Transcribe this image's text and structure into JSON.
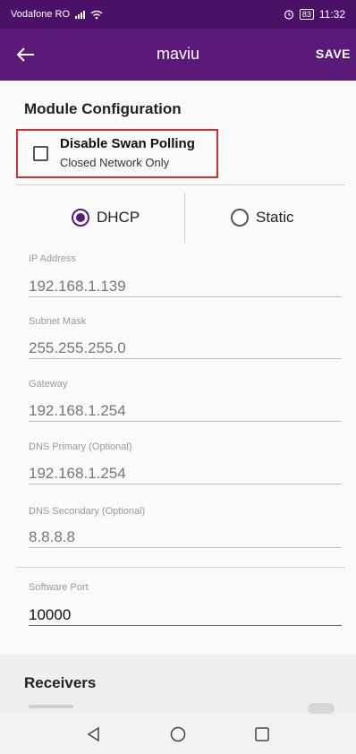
{
  "status_bar": {
    "carrier": "Vodafone RO",
    "battery": "83",
    "time": "11:32"
  },
  "toolbar": {
    "title": "maviu",
    "save_label": "SAVE"
  },
  "module": {
    "title": "Module Configuration",
    "disable_polling": {
      "label": "Disable Swan Polling",
      "sublabel": "Closed Network Only",
      "checked": false
    },
    "network_mode": {
      "options": [
        "DHCP",
        "Static"
      ],
      "selected": "DHCP"
    }
  },
  "fields": {
    "ip_address": {
      "label": "IP Address",
      "value": "192.168.1.139"
    },
    "subnet_mask": {
      "label": "Subnet Mask",
      "value": "255.255.255.0"
    },
    "gateway": {
      "label": "Gateway",
      "value": "192.168.1.254"
    },
    "dns_primary": {
      "label": "DNS Primary (Optional)",
      "value": "192.168.1.254"
    },
    "dns_secondary": {
      "label": "DNS Secondary (Optional)",
      "value": "8.8.8.8"
    },
    "software_port": {
      "label": "Software Port",
      "value": "10000"
    }
  },
  "receivers": {
    "title": "Receivers"
  },
  "icons": {
    "back": "arrow-left-icon",
    "nav_back": "triangle-back-icon",
    "nav_home": "circle-home-icon",
    "nav_recent": "square-recent-icon"
  },
  "colors": {
    "primary": "#5b1a7a",
    "status_bar": "#4a1166",
    "highlight": "#d32f2f"
  }
}
